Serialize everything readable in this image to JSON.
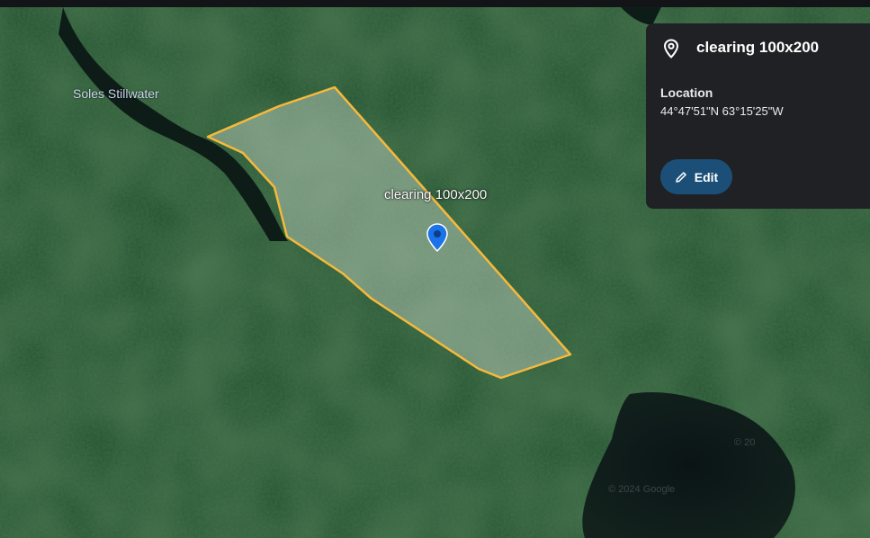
{
  "map": {
    "place_label": "Soles Stillwater",
    "polygon_label": "clearing 100x200",
    "attribution": "© 2024 Google",
    "attribution_partial": "© 20",
    "pin_color": "#1a73e8",
    "outline_color": "#f6b93b"
  },
  "panel": {
    "title": "clearing 100x200",
    "location_label": "Location",
    "coordinates": "44°47'51\"N 63°15'25\"W",
    "edit_label": "Edit",
    "icon": "location-pin-icon",
    "edit_icon": "pencil-icon"
  }
}
